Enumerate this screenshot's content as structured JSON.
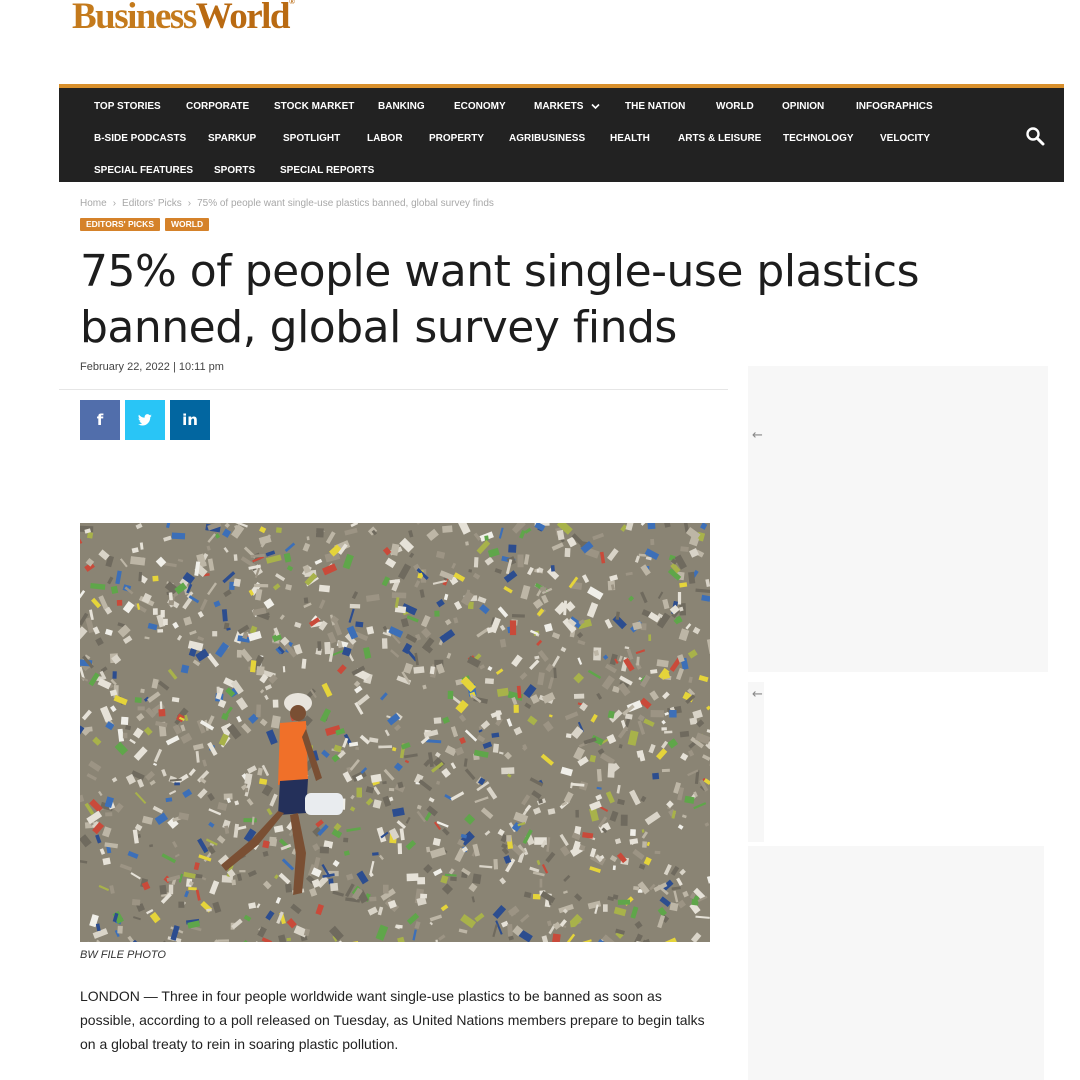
{
  "brand": {
    "name_business": "Business",
    "name_world": "World",
    "trademark": "®"
  },
  "nav": {
    "items": [
      "TOP STORIES",
      "CORPORATE",
      "STOCK MARKET",
      "BANKING",
      "ECONOMY",
      "MARKETS",
      "THE NATION",
      "WORLD",
      "OPINION",
      "INFOGRAPHICS",
      "B-SIDE PODCASTS",
      "SPARKUP",
      "SPOTLIGHT",
      "LABOR",
      "PROPERTY",
      "AGRIBUSINESS",
      "HEALTH",
      "ARTS & LEISURE",
      "TECHNOLOGY",
      "VELOCITY",
      "SPECIAL FEATURES",
      "SPORTS",
      "SPECIAL REPORTS"
    ],
    "markets_dropdown_icon": "chevron-down-icon",
    "search_icon": "search-icon"
  },
  "breadcrumb": {
    "home": "Home",
    "section": "Editors' Picks",
    "current": "75% of people want single-use plastics banned, global survey finds",
    "separator": "›"
  },
  "tags": [
    "EDITORS' PICKS",
    "WORLD"
  ],
  "article": {
    "title": "75% of people want single-use plastics banned, global survey finds",
    "date": "February 22, 2022 | 10:11 pm",
    "caption": "BW FILE PHOTO",
    "body": "LONDON — Three in four people worldwide want single-use plastics to be banned as soon as possible, according to a poll released on Tuesday, as United Nations members prepare to begin talks on a global treaty to rein in soaring plastic pollution."
  },
  "share": {
    "facebook": "f",
    "twitter_icon": "twitter-bird-icon",
    "linkedin": "in",
    "colors": {
      "facebook": "#516eab",
      "twitter": "#29c5f6",
      "linkedin": "#0266a0"
    }
  },
  "sidebar": {
    "arrow": "←"
  },
  "colors": {
    "accent": "#d9902c",
    "nav_bg": "#222222",
    "tag_bg": "#d5822a"
  }
}
